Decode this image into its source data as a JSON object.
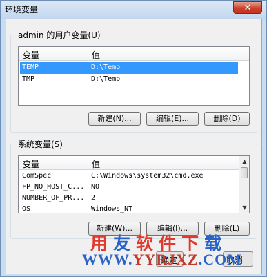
{
  "window": {
    "title": "环境变量",
    "close_glyph": "✕"
  },
  "user_vars": {
    "group_label": "admin 的用户变量(U)",
    "columns": [
      "变量",
      "值"
    ],
    "rows": [
      {
        "name": "TEMP",
        "value": "D:\\Temp",
        "selected": true
      },
      {
        "name": "TMP",
        "value": "D:\\Temp",
        "selected": false
      }
    ],
    "buttons": {
      "new": "新建(N)...",
      "edit": "编辑(E)...",
      "delete": "删除(D)"
    }
  },
  "system_vars": {
    "group_label": "系统变量(S)",
    "columns": [
      "变量",
      "值"
    ],
    "rows": [
      {
        "name": "ComSpec",
        "value": "C:\\Windows\\system32\\cmd.exe"
      },
      {
        "name": "FP_NO_HOST_C...",
        "value": "NO"
      },
      {
        "name": "NUMBER_OF_PR...",
        "value": "2"
      },
      {
        "name": "OS",
        "value": "Windows_NT"
      }
    ],
    "buttons": {
      "new": "新建(W)...",
      "edit": "编辑(I)...",
      "delete": "删除(L)"
    }
  },
  "footer": {
    "ok_partial": "确定",
    "cancel_partial": "取消"
  },
  "watermark": {
    "brand_chars": [
      {
        "ch": "用",
        "color": "#e03a2f"
      },
      {
        "ch": "友",
        "color": "#2a63c7"
      },
      {
        "ch": "软",
        "color": "#e03a2f"
      },
      {
        "ch": "件",
        "color": "#e03a2f"
      },
      {
        "ch": "下",
        "color": "#e03a2f"
      },
      {
        "ch": "载",
        "color": "#2a63c7"
      }
    ],
    "url_prefix": "WWW.",
    "url_domain": "YYRJXZ",
    "url_suffix": ".COM"
  },
  "icons": {
    "scroll_up": "up-arrow-icon",
    "scroll_down": "down-arrow-icon"
  }
}
